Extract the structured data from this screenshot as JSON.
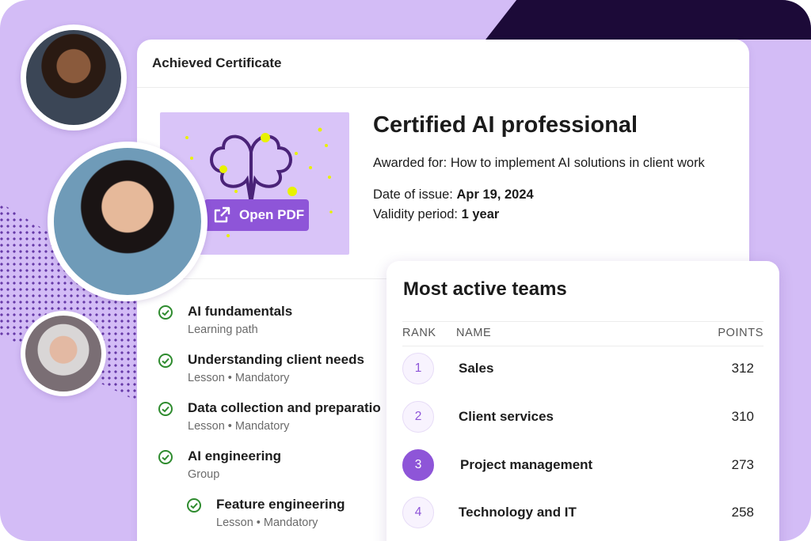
{
  "certificate": {
    "header": "Achieved Certificate",
    "title": "Certified AI professional",
    "awarded_label": "Awarded for:",
    "awarded_value": "How to implement AI solutions in client work",
    "date_label": "Date of issue:",
    "date_value": "Apr 19, 2024",
    "validity_label": "Validity period:",
    "validity_value": "1 year",
    "open_pdf_label": "Open PDF"
  },
  "learning_items": [
    {
      "title": "AI fundamentals",
      "subtitle": "Learning path"
    },
    {
      "title": "Understanding client needs",
      "subtitle": "Lesson • Mandatory"
    },
    {
      "title": "Data collection and preparatio",
      "subtitle": "Lesson • Mandatory"
    },
    {
      "title": "AI engineering",
      "subtitle": "Group"
    },
    {
      "title": "Feature engineering",
      "subtitle": "Lesson • Mandatory"
    }
  ],
  "teams": {
    "title": "Most active teams",
    "columns": {
      "rank": "RANK",
      "name": "NAME",
      "points": "POINTS"
    },
    "rows": [
      {
        "rank": "1",
        "name": "Sales",
        "points": "312"
      },
      {
        "rank": "2",
        "name": "Client services",
        "points": "310"
      },
      {
        "rank": "3",
        "name": "Project management",
        "points": "273"
      },
      {
        "rank": "4",
        "name": "Technology and IT",
        "points": "258"
      }
    ]
  },
  "colors": {
    "accent": "#8e55d8",
    "background": "#d3bcf6",
    "dark": "#1c0a38",
    "check": "#2e8b2e"
  }
}
